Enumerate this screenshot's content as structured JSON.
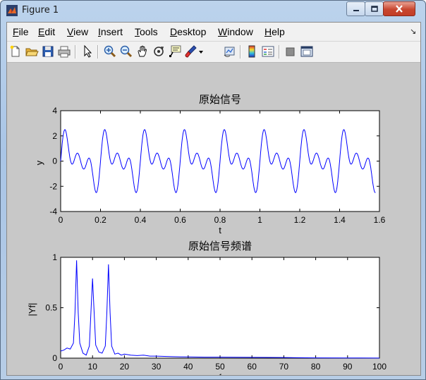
{
  "window": {
    "title": "Figure 1"
  },
  "menubar": {
    "items": [
      {
        "label": "File",
        "mnemonic": "F",
        "rest": "ile"
      },
      {
        "label": "Edit",
        "mnemonic": "E",
        "rest": "dit"
      },
      {
        "label": "View",
        "mnemonic": "V",
        "rest": "iew"
      },
      {
        "label": "Insert",
        "mnemonic": "I",
        "rest": "nsert"
      },
      {
        "label": "Tools",
        "mnemonic": "T",
        "rest": "ools"
      },
      {
        "label": "Desktop",
        "mnemonic": "D",
        "rest": "esktop"
      },
      {
        "label": "Window",
        "mnemonic": "W",
        "rest": "indow"
      },
      {
        "label": "Help",
        "mnemonic": "H",
        "rest": "elp"
      }
    ],
    "overflow_glyph": "↘"
  },
  "toolbar": {
    "buttons": [
      "new-figure-icon",
      "open-file-icon",
      "save-icon",
      "print-icon",
      "edit-plot-arrow-icon",
      "zoom-in-icon",
      "zoom-out-icon",
      "pan-hand-icon",
      "rotate-3d-icon",
      "data-cursor-icon",
      "brush-icon",
      "brush-dropdown-icon",
      "link-plot-icon",
      "colorbar-icon",
      "legend-icon",
      "hide-plot-tools-icon",
      "show-plot-tools-icon"
    ]
  },
  "colors": {
    "series": "#0000ff",
    "figure_bg": "#c8c8c8",
    "axes_bg": "#ffffff"
  },
  "chart_data": [
    {
      "type": "line",
      "title": "原始信号",
      "xlabel": "t",
      "ylabel": "y",
      "xlim": [
        0,
        1.6
      ],
      "ylim": [
        -4,
        4
      ],
      "xticks": [
        "0",
        "0.2",
        "0.4",
        "0.6",
        "0.8",
        "1",
        "1.2",
        "1.4",
        "1.6"
      ],
      "yticks": [
        "-4",
        "-2",
        "0",
        "2",
        "4"
      ],
      "grid": false,
      "series": [
        {
          "model": "y = sin(2π·5t) + sin(2π·10t) + sin(2π·15t)",
          "t_range": [
            0,
            1.58
          ],
          "period": 0.2,
          "peak_y": 2.5,
          "trough_y": -2.5
        }
      ]
    },
    {
      "type": "line",
      "title": "原始信号频谱",
      "xlabel": "f",
      "ylabel": "|Yf|",
      "xlim": [
        0,
        100
      ],
      "ylim": [
        0,
        1
      ],
      "xticks": [
        "0",
        "10",
        "20",
        "30",
        "40",
        "50",
        "60",
        "70",
        "80",
        "90",
        "100"
      ],
      "yticks": [
        "0",
        "0.5",
        "1"
      ],
      "grid": false,
      "series": [
        {
          "x": [
            0,
            1,
            2,
            3,
            4,
            4.5,
            5,
            5.5,
            6,
            7,
            8,
            9,
            9.5,
            10,
            10.5,
            11,
            12,
            13,
            14,
            14.5,
            15,
            15.5,
            16,
            17,
            18,
            19,
            20,
            22,
            24,
            26,
            28,
            30,
            35,
            40,
            45,
            50,
            60,
            70,
            74,
            80,
            90,
            100
          ],
          "y": [
            0.07,
            0.08,
            0.1,
            0.09,
            0.15,
            0.45,
            0.97,
            0.45,
            0.15,
            0.05,
            0.03,
            0.12,
            0.45,
            0.79,
            0.45,
            0.13,
            0.06,
            0.05,
            0.12,
            0.45,
            0.93,
            0.45,
            0.12,
            0.04,
            0.05,
            0.03,
            0.04,
            0.03,
            0.025,
            0.03,
            0.02,
            0.02,
            0.015,
            0.012,
            0.01,
            0.01,
            0.008,
            0.006,
            0.004,
            0.003,
            0.002,
            0.001
          ]
        }
      ]
    }
  ]
}
